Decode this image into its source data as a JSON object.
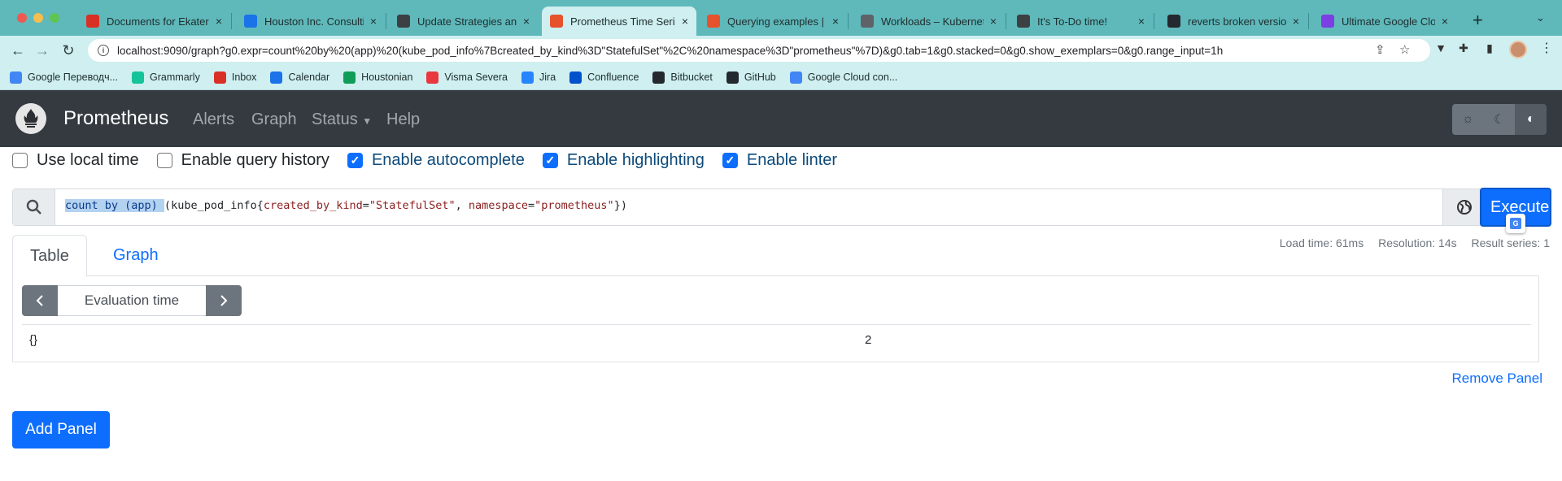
{
  "browser": {
    "tabs": [
      {
        "title": "Documents for Ekaterina",
        "icon": "gmail-icon",
        "color": "#d93025"
      },
      {
        "title": "Houston Inc. Consulting",
        "icon": "calendar-icon",
        "color": "#1a73e8"
      },
      {
        "title": "Update Strategies and",
        "icon": "globe-icon",
        "color": "#3c4043"
      },
      {
        "title": "Prometheus Time Series",
        "icon": "prometheus-icon",
        "color": "#e6522c",
        "active": true
      },
      {
        "title": "Querying examples | P",
        "icon": "prometheus-icon",
        "color": "#e6522c"
      },
      {
        "title": "Workloads – Kubernetes",
        "icon": "gear-icon",
        "color": "#5f6368"
      },
      {
        "title": "It's To-Do time!",
        "icon": "globe-icon",
        "color": "#3c4043"
      },
      {
        "title": "reverts broken version",
        "icon": "github-icon",
        "color": "#24292f"
      },
      {
        "title": "Ultimate Google Cloud",
        "icon": "shield-icon",
        "color": "#7b3fe4"
      }
    ],
    "url": "localhost:9090/graph?g0.expr=count%20by%20(app)%20(kube_pod_info%7Bcreated_by_kind%3D\"StatefulSet\"%2C%20namespace%3D\"prometheus\"%7D)&g0.tab=1&g0.stacked=0&g0.show_exemplars=0&g0.range_input=1h",
    "bookmarks": [
      {
        "label": "Google Переводч...",
        "icon": "translate-icon",
        "color": "#4285f4"
      },
      {
        "label": "Grammarly",
        "icon": "grammarly-icon",
        "color": "#15c39a"
      },
      {
        "label": "Inbox",
        "icon": "gmail-icon",
        "color": "#d93025"
      },
      {
        "label": "Calendar",
        "icon": "calendar-icon",
        "color": "#1a73e8"
      },
      {
        "label": "Houstonian",
        "icon": "drive-icon",
        "color": "#0f9d58"
      },
      {
        "label": "Visma Severa",
        "icon": "visma-icon",
        "color": "#e8373d"
      },
      {
        "label": "Jira",
        "icon": "jira-icon",
        "color": "#2684ff"
      },
      {
        "label": "Confluence",
        "icon": "confluence-icon",
        "color": "#0052cc"
      },
      {
        "label": "Bitbucket",
        "icon": "bitbucket-icon",
        "color": "#24292f"
      },
      {
        "label": "GitHub",
        "icon": "github-icon",
        "color": "#24292f"
      },
      {
        "label": "Google Cloud con...",
        "icon": "cloud-icon",
        "color": "#4285f4"
      }
    ]
  },
  "app": {
    "brand": "Prometheus",
    "nav": {
      "alerts": "Alerts",
      "graph": "Graph",
      "status": "Status",
      "help": "Help"
    }
  },
  "options": {
    "local_time": "Use local time",
    "query_history": "Enable query history",
    "autocomplete": "Enable autocomplete",
    "highlighting": "Enable highlighting",
    "linter": "Enable linter"
  },
  "query": {
    "part_selected": "count by (app) ",
    "part_paren": "(",
    "part_metric": "kube_pod_info{",
    "label1": "created_by_kind",
    "eq1": "=",
    "val1": "\"StatefulSet\"",
    "sep": ", ",
    "label2": "namespace",
    "eq2": "=",
    "val2": "\"prometheus\"",
    "close": "})",
    "execute_label": "Execute"
  },
  "stats": {
    "load_time": "Load time: 61ms",
    "resolution": "Resolution: 14s",
    "result_series": "Result series: 1"
  },
  "panel": {
    "tab_table": "Table",
    "tab_graph": "Graph",
    "eval_time_placeholder": "Evaluation time",
    "result": {
      "labels": "{}",
      "value": "2"
    },
    "remove_label": "Remove Panel"
  },
  "add_panel_label": "Add Panel"
}
